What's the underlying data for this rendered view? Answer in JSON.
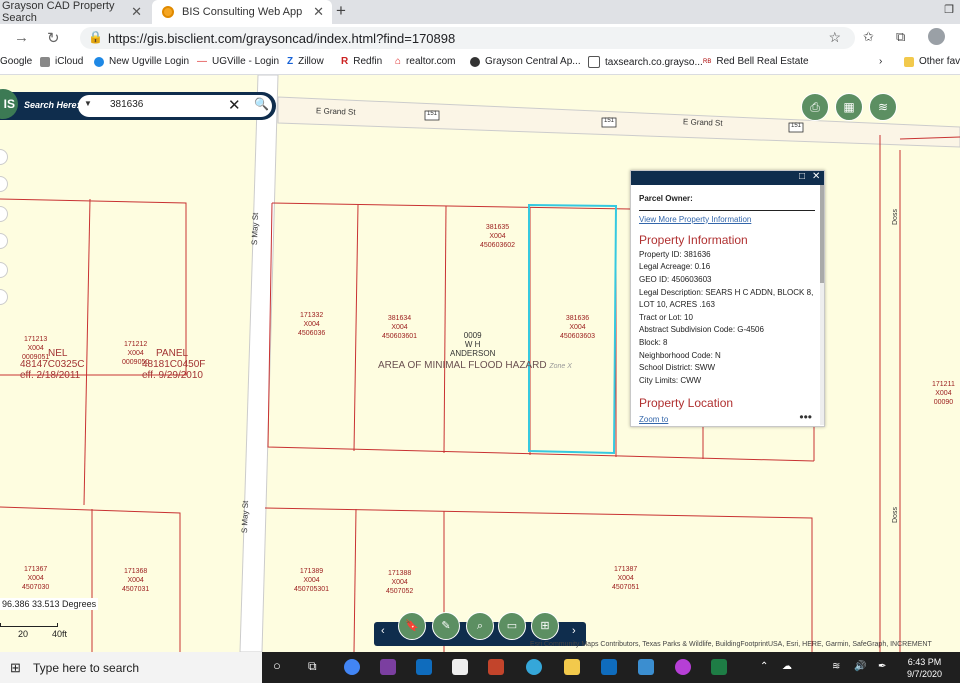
{
  "browser": {
    "tabs": [
      {
        "label": "Grayson CAD Property Search",
        "active": false
      },
      {
        "label": "BIS Consulting Web App",
        "active": true
      }
    ],
    "url": "https://gis.bisclient.com/graysoncad/index.html?find=170898",
    "bookmarks": [
      "Google",
      "iCloud",
      "New Ugville Login",
      "UGVille - Login",
      "Zillow",
      "Redfin",
      "realtor.com",
      "Grayson Central Ap...",
      "taxsearch.co.grayso...",
      "Red Bell Real Estate",
      "Other fav"
    ]
  },
  "search": {
    "label": "Search Here:",
    "value": "381636",
    "logo": "IS"
  },
  "streets": {
    "grand": "E Grand St",
    "grand2": "E Grand St",
    "may1": "S May St",
    "may2": "S May St",
    "doss1": "Doss",
    "doss2": "Doss",
    "hwy1": "151",
    "hwy2": "151",
    "hwy3": "151"
  },
  "parcels": [
    {
      "id": "171213",
      "sub": "X004",
      "geo": "0009051"
    },
    {
      "id": "171212",
      "sub": "X004",
      "geo": "0009050"
    },
    {
      "id": "171332",
      "sub": "X004",
      "geo": "4506036"
    },
    {
      "id": "381634",
      "sub": "X004",
      "geo": "450603601"
    },
    {
      "id": "381635",
      "sub": "X004",
      "geo": "450603602"
    },
    {
      "id": "381636",
      "sub": "X004",
      "geo": "450603603"
    },
    {
      "id": "171211",
      "sub": "X004",
      "geo": "00090"
    },
    {
      "id": "171367",
      "sub": "X004",
      "geo": "4507030"
    },
    {
      "id": "171368",
      "sub": "X004",
      "geo": "4507031"
    },
    {
      "id": "171389",
      "sub": "X004",
      "geo": "450705301"
    },
    {
      "id": "171388",
      "sub": "X004",
      "geo": "4507052"
    },
    {
      "id": "171387",
      "sub": "X004",
      "geo": "4507051"
    }
  ],
  "flood": {
    "panel1": "NEL",
    "panel1_code": "48147C0325C",
    "panel1_eff": "eff. 2/18/2011",
    "panel2": "PANEL",
    "panel2_code": "48181C0450F",
    "panel2_eff": "eff. 9/29/2010",
    "area": "AREA OF MINIMAL FLOOD HAZARD",
    "zone": "Zone X"
  },
  "subdivision": {
    "line1": "0009",
    "line2": "W H",
    "line3": "ANDERSON"
  },
  "popup": {
    "owner_label": "Parcel Owner:",
    "link": "View More Property Information",
    "section": "Property Information",
    "fields": [
      "Property ID: 381636",
      "Legal Acreage: 0.16",
      "GEO ID: 450603603",
      "Legal Description: SEARS H C ADDN, BLOCK 8, LOT 10, ACRES .163",
      "Tract or Lot: 10",
      "Abstract Subdivision Code: G-4506",
      "Block: 8",
      "Neighborhood Code: N",
      "School District: SWW",
      "City Limits: CWW"
    ],
    "section2": "Property Location",
    "zoom": "Zoom to",
    "more": "•••"
  },
  "coords": "96.386 33.513 Degrees",
  "scale": {
    "a": "20",
    "b": "40ft"
  },
  "attribution": "Esri Community Maps Contributors, Texas Parks & Wildlife, BuildingFootprintUSA, Esri, HERE, Garmin, SafeGraph, INCREMENT",
  "taskbar": {
    "search": "Type here to search",
    "time": "6:43 PM",
    "date": "9/7/2020"
  },
  "colors": {
    "navy": "#0f2d4d",
    "green": "#5c8f62",
    "parcel": "#c83232",
    "selected": "#35c9e0",
    "map_bg": "#fefde0"
  }
}
